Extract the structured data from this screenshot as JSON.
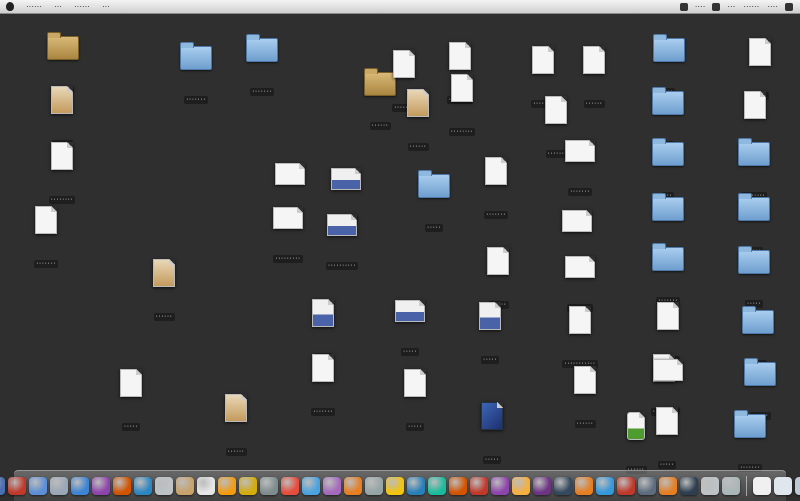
{
  "menubar": {
    "app_menu_items": [
      "······",
      "···",
      "······",
      "···"
    ],
    "status_items": [
      "····",
      "···",
      "······",
      "····"
    ]
  },
  "desktop": {
    "items": [
      {
        "kind": "folder brown",
        "label": "······"
      },
      {
        "kind": "doc tan",
        "label": "······"
      },
      {
        "kind": "doc",
        "label": "········"
      },
      {
        "kind": "doc",
        "label": "·······"
      },
      {
        "kind": "folder",
        "label": "·······"
      },
      {
        "kind": "folder",
        "label": "·······"
      },
      {
        "kind": "folder brown",
        "label": "······"
      },
      {
        "kind": "doc",
        "label": "·······"
      },
      {
        "kind": "doc",
        "label": "········"
      },
      {
        "kind": "doc tan",
        "label": "······"
      },
      {
        "kind": "doc",
        "label": "········"
      },
      {
        "kind": "doc",
        "label": "·······"
      },
      {
        "kind": "doc",
        "label": "······"
      },
      {
        "kind": "doc",
        "label": "······"
      },
      {
        "kind": "folder",
        "label": "···"
      },
      {
        "kind": "folder",
        "label": "···"
      },
      {
        "kind": "folder",
        "label": "···"
      },
      {
        "kind": "folder",
        "label": "···"
      },
      {
        "kind": "doc",
        "label": "·····"
      },
      {
        "kind": "doc",
        "label": "······"
      },
      {
        "kind": "doc wide",
        "label": "········"
      },
      {
        "kind": "doc wide pic",
        "label": "·······"
      },
      {
        "kind": "doc wide",
        "label": "·········"
      },
      {
        "kind": "doc wide pic",
        "label": "··········"
      },
      {
        "kind": "folder",
        "label": "·····"
      },
      {
        "kind": "doc",
        "label": "·······"
      },
      {
        "kind": "doc wide",
        "label": "·······"
      },
      {
        "kind": "folder",
        "label": "········"
      },
      {
        "kind": "folder",
        "label": "·····"
      },
      {
        "kind": "doc tan",
        "label": "······"
      },
      {
        "kind": "doc wide",
        "label": "·······"
      },
      {
        "kind": "doc",
        "label": "······"
      },
      {
        "kind": "doc wide",
        "label": "········"
      },
      {
        "kind": "folder",
        "label": "·······"
      },
      {
        "kind": "folder",
        "label": "·····"
      },
      {
        "kind": "doc pic",
        "label": "·····"
      },
      {
        "kind": "doc wide pic",
        "label": "·····"
      },
      {
        "kind": "doc pic",
        "label": "·····"
      },
      {
        "kind": "doc",
        "label": "···········"
      },
      {
        "kind": "doc",
        "label": "·······"
      },
      {
        "kind": "folder",
        "label": "·····"
      },
      {
        "kind": "doc",
        "label": "·······"
      },
      {
        "kind": "doc",
        "label": "·····"
      },
      {
        "kind": "doc",
        "label": "······"
      },
      {
        "kind": "doc",
        "label": "········"
      },
      {
        "kind": "doc wide",
        "label": "·······"
      },
      {
        "kind": "folder",
        "label": "······"
      },
      {
        "kind": "doc tan",
        "label": "······"
      },
      {
        "kind": "doc",
        "label": "·····"
      },
      {
        "kind": "doc photo",
        "label": "·····"
      },
      {
        "kind": "doc bottle",
        "label": "······"
      },
      {
        "kind": "doc",
        "label": "·····"
      },
      {
        "kind": "folder",
        "label": "·······"
      }
    ]
  },
  "dock": {
    "colors": [
      "#4a6fb3",
      "#c0392b",
      "#5c8fd6",
      "#9aa7b8",
      "#3d84d4",
      "#8e44ad",
      "#d35400",
      "#2e86c1",
      "#bdc3c7",
      "#c8a26a",
      "#e6e6e6",
      "#f39c12",
      "#d4ac0d",
      "#7f8c8d",
      "#e74c3c",
      "#4aa3df",
      "#a569bd",
      "#e67e22",
      "#95a5a6",
      "#f1c40f",
      "#2980b9",
      "#1abc9c",
      "#d35400",
      "#c0392b",
      "#8e44ad",
      "#f5b041",
      "#6c3483",
      "#34495e",
      "#e67e22",
      "#3498db",
      "#c0392b",
      "#5d6d7e",
      "#e67e22",
      "#2c3e50",
      "#bdc3c7",
      "#aab7b8"
    ],
    "trailing": [
      "#f0f0f0",
      "#dfe6ee",
      "#bfc9d6"
    ]
  }
}
